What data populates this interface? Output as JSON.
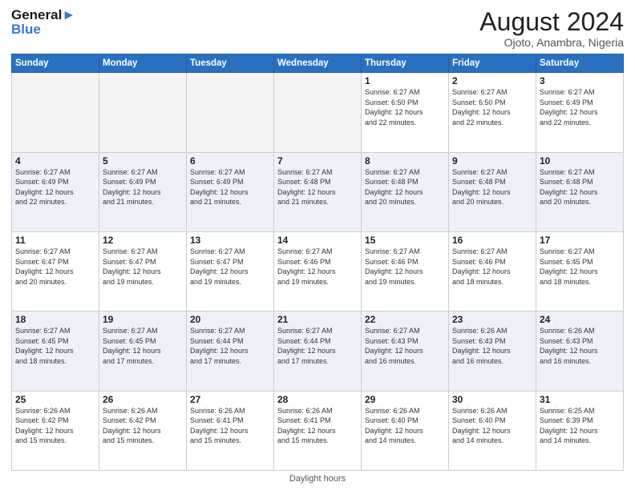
{
  "logo": {
    "line1": "General",
    "line2": "Blue"
  },
  "title": "August 2024",
  "location": "Ojoto, Anambra, Nigeria",
  "days_of_week": [
    "Sunday",
    "Monday",
    "Tuesday",
    "Wednesday",
    "Thursday",
    "Friday",
    "Saturday"
  ],
  "weeks": [
    [
      {
        "num": "",
        "info": ""
      },
      {
        "num": "",
        "info": ""
      },
      {
        "num": "",
        "info": ""
      },
      {
        "num": "",
        "info": ""
      },
      {
        "num": "1",
        "info": "Sunrise: 6:27 AM\nSunset: 6:50 PM\nDaylight: 12 hours\nand 22 minutes."
      },
      {
        "num": "2",
        "info": "Sunrise: 6:27 AM\nSunset: 6:50 PM\nDaylight: 12 hours\nand 22 minutes."
      },
      {
        "num": "3",
        "info": "Sunrise: 6:27 AM\nSunset: 6:49 PM\nDaylight: 12 hours\nand 22 minutes."
      }
    ],
    [
      {
        "num": "4",
        "info": "Sunrise: 6:27 AM\nSunset: 6:49 PM\nDaylight: 12 hours\nand 22 minutes."
      },
      {
        "num": "5",
        "info": "Sunrise: 6:27 AM\nSunset: 6:49 PM\nDaylight: 12 hours\nand 21 minutes."
      },
      {
        "num": "6",
        "info": "Sunrise: 6:27 AM\nSunset: 6:49 PM\nDaylight: 12 hours\nand 21 minutes."
      },
      {
        "num": "7",
        "info": "Sunrise: 6:27 AM\nSunset: 6:48 PM\nDaylight: 12 hours\nand 21 minutes."
      },
      {
        "num": "8",
        "info": "Sunrise: 6:27 AM\nSunset: 6:48 PM\nDaylight: 12 hours\nand 20 minutes."
      },
      {
        "num": "9",
        "info": "Sunrise: 6:27 AM\nSunset: 6:48 PM\nDaylight: 12 hours\nand 20 minutes."
      },
      {
        "num": "10",
        "info": "Sunrise: 6:27 AM\nSunset: 6:48 PM\nDaylight: 12 hours\nand 20 minutes."
      }
    ],
    [
      {
        "num": "11",
        "info": "Sunrise: 6:27 AM\nSunset: 6:47 PM\nDaylight: 12 hours\nand 20 minutes."
      },
      {
        "num": "12",
        "info": "Sunrise: 6:27 AM\nSunset: 6:47 PM\nDaylight: 12 hours\nand 19 minutes."
      },
      {
        "num": "13",
        "info": "Sunrise: 6:27 AM\nSunset: 6:47 PM\nDaylight: 12 hours\nand 19 minutes."
      },
      {
        "num": "14",
        "info": "Sunrise: 6:27 AM\nSunset: 6:46 PM\nDaylight: 12 hours\nand 19 minutes."
      },
      {
        "num": "15",
        "info": "Sunrise: 6:27 AM\nSunset: 6:46 PM\nDaylight: 12 hours\nand 19 minutes."
      },
      {
        "num": "16",
        "info": "Sunrise: 6:27 AM\nSunset: 6:46 PM\nDaylight: 12 hours\nand 18 minutes."
      },
      {
        "num": "17",
        "info": "Sunrise: 6:27 AM\nSunset: 6:45 PM\nDaylight: 12 hours\nand 18 minutes."
      }
    ],
    [
      {
        "num": "18",
        "info": "Sunrise: 6:27 AM\nSunset: 6:45 PM\nDaylight: 12 hours\nand 18 minutes."
      },
      {
        "num": "19",
        "info": "Sunrise: 6:27 AM\nSunset: 6:45 PM\nDaylight: 12 hours\nand 17 minutes."
      },
      {
        "num": "20",
        "info": "Sunrise: 6:27 AM\nSunset: 6:44 PM\nDaylight: 12 hours\nand 17 minutes."
      },
      {
        "num": "21",
        "info": "Sunrise: 6:27 AM\nSunset: 6:44 PM\nDaylight: 12 hours\nand 17 minutes."
      },
      {
        "num": "22",
        "info": "Sunrise: 6:27 AM\nSunset: 6:43 PM\nDaylight: 12 hours\nand 16 minutes."
      },
      {
        "num": "23",
        "info": "Sunrise: 6:26 AM\nSunset: 6:43 PM\nDaylight: 12 hours\nand 16 minutes."
      },
      {
        "num": "24",
        "info": "Sunrise: 6:26 AM\nSunset: 6:43 PM\nDaylight: 12 hours\nand 16 minutes."
      }
    ],
    [
      {
        "num": "25",
        "info": "Sunrise: 6:26 AM\nSunset: 6:42 PM\nDaylight: 12 hours\nand 15 minutes."
      },
      {
        "num": "26",
        "info": "Sunrise: 6:26 AM\nSunset: 6:42 PM\nDaylight: 12 hours\nand 15 minutes."
      },
      {
        "num": "27",
        "info": "Sunrise: 6:26 AM\nSunset: 6:41 PM\nDaylight: 12 hours\nand 15 minutes."
      },
      {
        "num": "28",
        "info": "Sunrise: 6:26 AM\nSunset: 6:41 PM\nDaylight: 12 hours\nand 15 minutes."
      },
      {
        "num": "29",
        "info": "Sunrise: 6:26 AM\nSunset: 6:40 PM\nDaylight: 12 hours\nand 14 minutes."
      },
      {
        "num": "30",
        "info": "Sunrise: 6:26 AM\nSunset: 6:40 PM\nDaylight: 12 hours\nand 14 minutes."
      },
      {
        "num": "31",
        "info": "Sunrise: 6:25 AM\nSunset: 6:39 PM\nDaylight: 12 hours\nand 14 minutes."
      }
    ]
  ],
  "footer": "Daylight hours"
}
